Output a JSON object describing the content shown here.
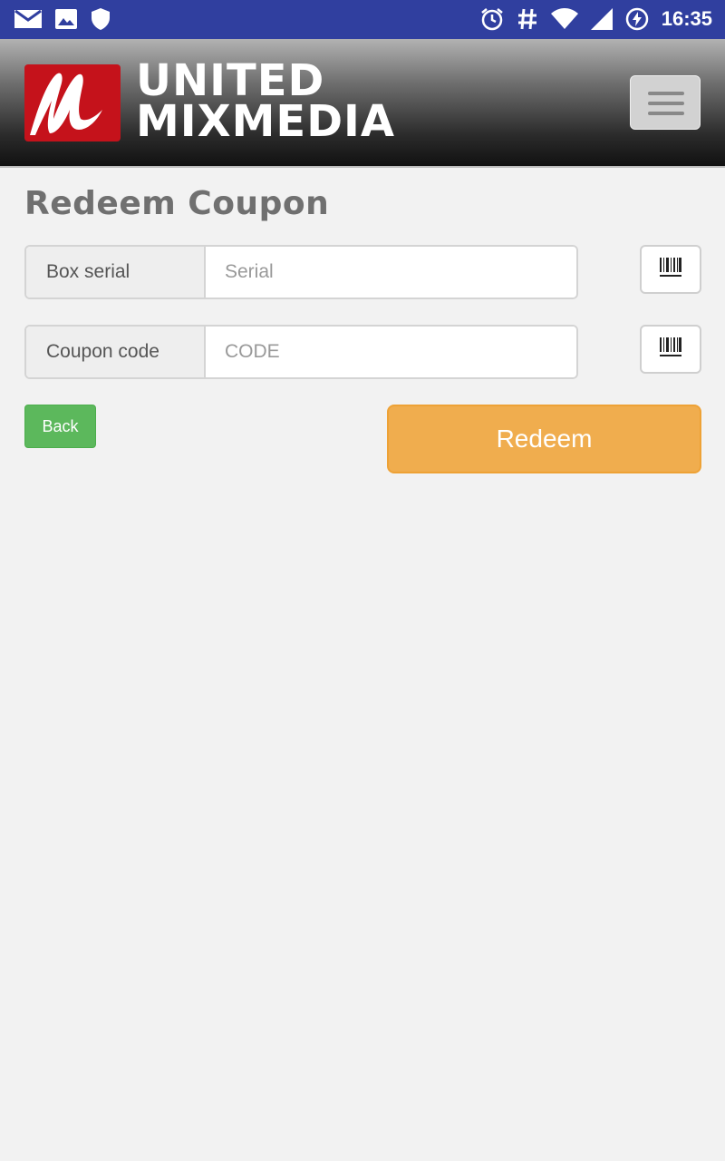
{
  "status_bar": {
    "time": "16:35",
    "left_icons": [
      "mail-icon",
      "image-icon",
      "shield-icon"
    ],
    "right_icons": [
      "alarm-icon",
      "hash-icon",
      "wifi-icon",
      "signal-icon",
      "battery-charging-icon"
    ]
  },
  "header": {
    "brand_line1": "UNITED",
    "brand_line2": "MIXMEDIA",
    "menu_icon": "hamburger-menu-icon"
  },
  "page": {
    "title": "Redeem Coupon"
  },
  "form": {
    "serial": {
      "label": "Box serial",
      "placeholder": "Serial",
      "value": "",
      "scan_icon": "barcode-icon"
    },
    "code": {
      "label": "Coupon code",
      "placeholder": "CODE",
      "value": "",
      "scan_icon": "barcode-icon"
    }
  },
  "actions": {
    "back_label": "Back",
    "redeem_label": "Redeem"
  },
  "colors": {
    "status_bar": "#303f9f",
    "brand_red": "#c5121b",
    "back_green": "#5cb85c",
    "redeem_orange": "#f0ad4e",
    "background": "#f2f2f2"
  }
}
